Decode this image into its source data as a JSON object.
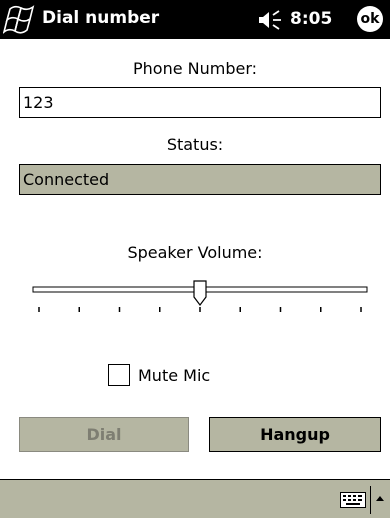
{
  "window": {
    "title": "Dial number",
    "clock": "8:05",
    "ok_label": "ok"
  },
  "colors": {
    "titlebar": "#000000",
    "panel_gray": "#b5b6a2",
    "disabled_text": "#7e7e72"
  },
  "icons": {
    "start": "windows-flag-icon",
    "speaker": "speaker-icon",
    "keyboard": "keyboard-icon",
    "sip_arrow": "up-arrow-icon"
  },
  "form": {
    "phone_label": "Phone Number:",
    "phone_value": "123",
    "status_label": "Status:",
    "status_value": "Connected",
    "volume_label": "Speaker Volume:",
    "volume": {
      "min": 0,
      "max": 8,
      "value": 4
    },
    "mute_label": "Mute Mic",
    "mute_checked": false
  },
  "buttons": {
    "dial": "Dial",
    "hangup": "Hangup"
  }
}
